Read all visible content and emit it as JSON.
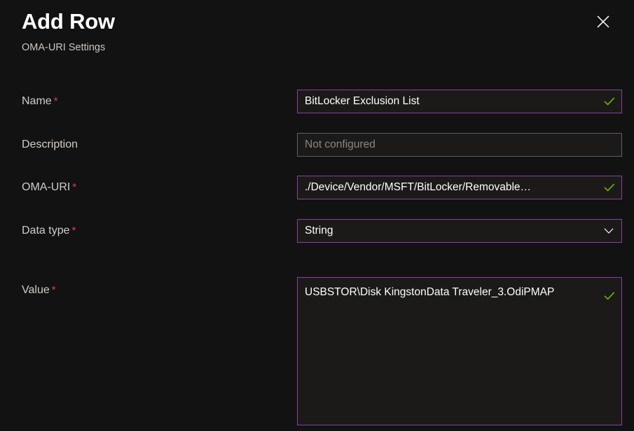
{
  "header": {
    "title": "Add Row",
    "subtitle": "OMA-URI Settings",
    "close_icon": "close-icon"
  },
  "colors": {
    "background": "#121212",
    "field_background": "#1b1a19",
    "focus_border": "#8b3fa0",
    "neutral_border": "#605e5c",
    "required_asterisk": "#e03e52",
    "valid_check": "#6bb700",
    "label_text": "#cfcdcb",
    "value_text": "#ffffff",
    "placeholder_text": "#8a8886"
  },
  "form": {
    "required_marker": "*",
    "fields": [
      {
        "key": "name",
        "label": "Name",
        "required": true,
        "type": "text",
        "value": "BitLocker Exclusion List",
        "placeholder": "",
        "validated": true
      },
      {
        "key": "description",
        "label": "Description",
        "required": false,
        "type": "text",
        "value": "",
        "placeholder": "Not configured",
        "validated": false
      },
      {
        "key": "oma_uri",
        "label": "OMA-URI",
        "required": true,
        "type": "text",
        "value": "./Device/Vendor/MSFT/BitLocker/Removable…",
        "placeholder": "",
        "validated": true
      },
      {
        "key": "data_type",
        "label": "Data type",
        "required": true,
        "type": "select",
        "value": "String",
        "placeholder": "",
        "validated": false
      },
      {
        "key": "value",
        "label": "Value",
        "required": true,
        "type": "textarea",
        "value": "USBSTOR\\Disk KingstonData Traveler_3.OdiPMAP",
        "placeholder": "",
        "validated": true
      }
    ]
  }
}
